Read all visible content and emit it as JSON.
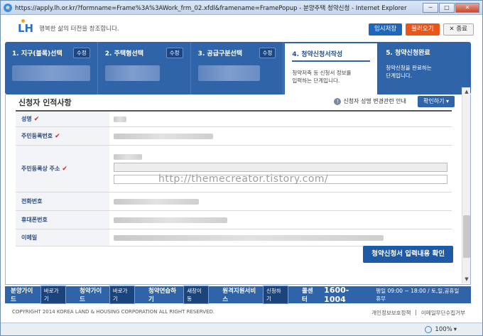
{
  "window": {
    "title": "https://apply.lh.or.kr/?formname=Frame%3A%3AWork_frm_02.xfdl&framename=FramePopup - 분양주택 청약신청 - Internet Explorer",
    "min": "─",
    "max": "□",
    "close": "✕"
  },
  "header": {
    "logo": "LH",
    "tagline": "행복한 삶의 터전을 창조합니다.",
    "temp_save": "임시저장",
    "load": "불러오기",
    "close": "✕ 종료"
  },
  "steps": [
    {
      "label": "1. 지구(블록)선택",
      "mod": "수정"
    },
    {
      "label": "2. 주택형선택",
      "mod": "수정"
    },
    {
      "label": "3. 공급구분선택",
      "mod": "수정"
    },
    {
      "label": "4. 청약신청서작성",
      "desc1": "청약저축 등 신청서 정보를",
      "desc2": "입력하는 단계입니다."
    },
    {
      "label": "5. 청약신청완료",
      "desc1": "청약신청을 완료하는",
      "desc2": "단계입니다."
    }
  ],
  "section": {
    "title": "신청자 인적사항",
    "notice_icon": "!",
    "notice": "신청자 성명 변경관련 안내",
    "confirm": "확인하기 ▾"
  },
  "rows": [
    {
      "label": "성명",
      "required": "✔"
    },
    {
      "label": "주민등록번호",
      "required": "✔"
    },
    {
      "label": "주민등록상 주소",
      "required": "✔"
    },
    {
      "label": "전화번호"
    },
    {
      "label": "휴대폰번호"
    },
    {
      "label": "이메일"
    }
  ],
  "watermark": "http://themecreator.tistory.com/",
  "submit": "청약신청서 입력내용 확인",
  "footer": {
    "guide1": "분양가이드",
    "guide1_btn": "바로가기",
    "guide2": "청약가이드",
    "guide2_btn": "바로가기",
    "guide3": "청약연습하기",
    "guide3_btn": "새창이동",
    "guide4": "원격지원서비스",
    "guide4_btn": "신청하기",
    "call_label": "콜센터",
    "tel": "1600-1004",
    "hours": "평일 09:00 ~ 18:00 / 토,일,공휴일 휴무"
  },
  "copyright": "COPYRIGHT 2014 KOREA LAND & HOUSING CORPORATION ALL RIGHT RESERVED.",
  "links": [
    "개인정보보호정책",
    "|",
    "이메일무단수집거부"
  ],
  "zoom": "100%",
  "zoom_arrow": "▾"
}
